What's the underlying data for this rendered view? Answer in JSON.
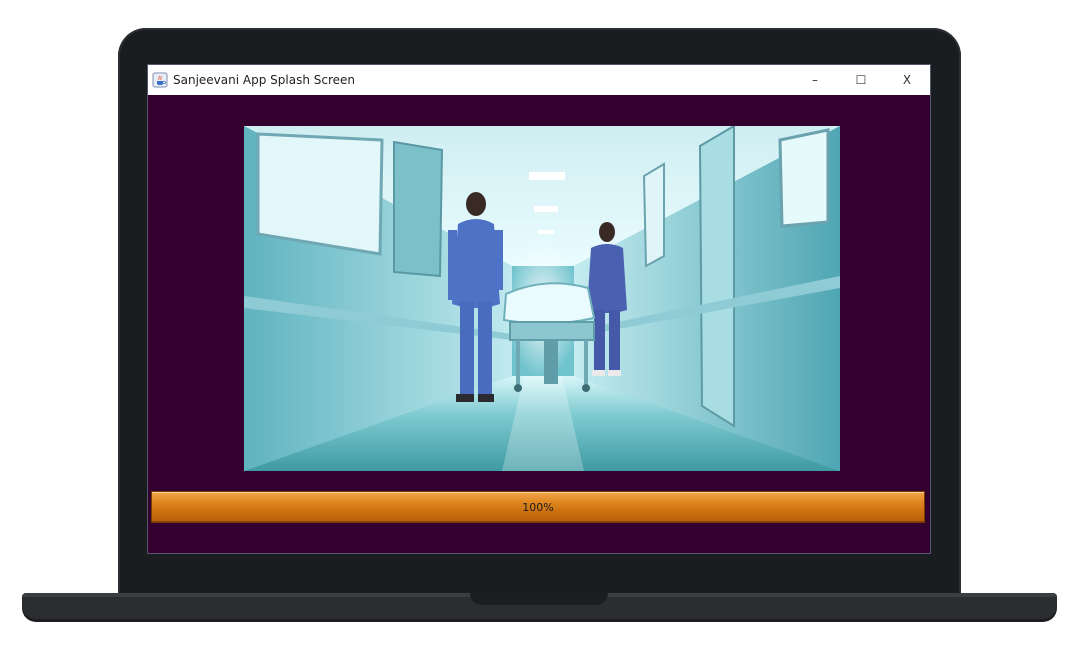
{
  "window": {
    "title": "Sanjeevani App Splash Screen",
    "controls": {
      "minimize": "–",
      "maximize": "☐",
      "close": "X"
    }
  },
  "splash": {
    "image_subject": "hospital-corridor-with-staff-pushing-stretcher"
  },
  "progress": {
    "value": 100,
    "label": "100%"
  },
  "colors": {
    "window_background": "#33002f",
    "progress_fill": "#d67a16"
  }
}
